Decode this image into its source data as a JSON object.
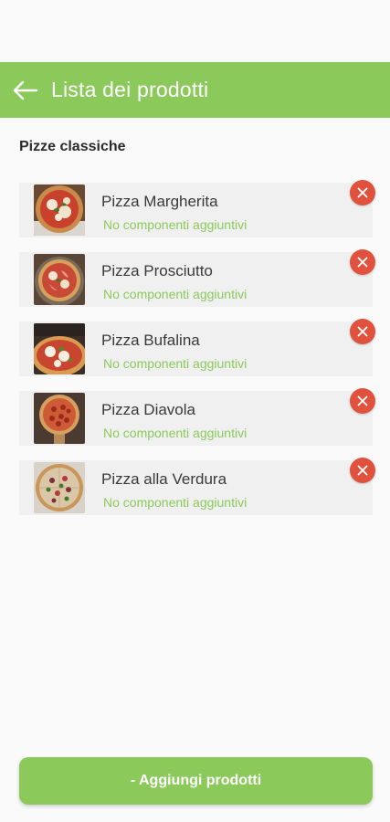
{
  "app_bar": {
    "title": "Lista dei prodotti"
  },
  "section": {
    "title": "Pizze classiche"
  },
  "items": [
    {
      "name": "Pizza Margherita",
      "subtitle": "No componenti aggiuntivi"
    },
    {
      "name": "Pizza Prosciutto",
      "subtitle": "No componenti aggiuntivi"
    },
    {
      "name": "Pizza Bufalina",
      "subtitle": "No componenti aggiuntivi"
    },
    {
      "name": "Pizza Diavola",
      "subtitle": "No componenti aggiuntivi"
    },
    {
      "name": "Pizza alla Verdura",
      "subtitle": "No componenti aggiuntivi"
    }
  ],
  "footer": {
    "button_label": "- Aggiungi prodotti"
  },
  "icons": {
    "back": "arrow-left-icon",
    "remove": "close-icon"
  },
  "colors": {
    "accent": "#8bc95b",
    "remove": "#e0523d",
    "background": "#fafafa",
    "card": "#f0f0f0"
  }
}
